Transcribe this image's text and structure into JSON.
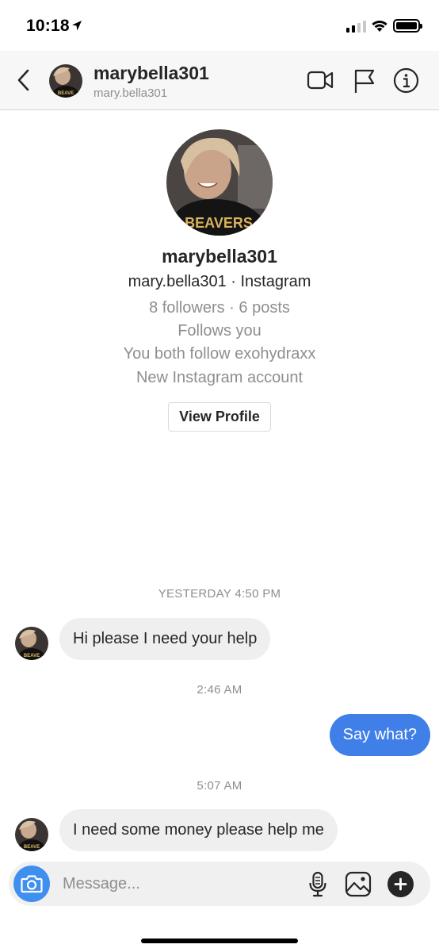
{
  "status_bar": {
    "time": "10:18"
  },
  "header": {
    "display_name": "marybella301",
    "username": "mary.bella301",
    "icons": [
      "back-chevron-icon",
      "video-call-icon",
      "flag-icon",
      "info-icon"
    ]
  },
  "profile": {
    "name": "marybella301",
    "handle_line": "mary.bella301 · Instagram",
    "stats_line": "8 followers · 6 posts",
    "follows_line": "Follows you",
    "mutual_line": "You both follow exohydraxx",
    "account_note": "New Instagram account",
    "view_profile_label": "View Profile"
  },
  "avatar_shirt_text": "BEAVERS",
  "messages": [
    {
      "type": "timestamp",
      "text": "YESTERDAY 4:50 PM"
    },
    {
      "type": "incoming",
      "text": "Hi please I need your help"
    },
    {
      "type": "timestamp",
      "text": "2:46 AM"
    },
    {
      "type": "outgoing",
      "text": "Say what?"
    },
    {
      "type": "timestamp",
      "text": "5:07 AM"
    },
    {
      "type": "incoming",
      "text": "I need some money please help  me"
    }
  ],
  "composer": {
    "placeholder": "Message...",
    "icons": [
      "camera-icon",
      "microphone-icon",
      "gallery-icon",
      "plus-icon"
    ]
  },
  "colors": {
    "outgoing_bubble": "#3f7fe7",
    "incoming_bubble": "#efefef",
    "camera_button": "#3f8ff0",
    "secondary_text": "#8e8e8e"
  }
}
